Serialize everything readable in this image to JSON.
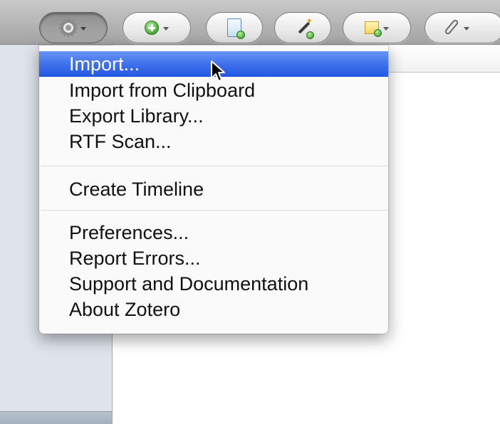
{
  "toolbar": {
    "buttons": [
      {
        "name": "actions",
        "icon": "gear-icon",
        "has_menu": true,
        "pressed": true
      },
      {
        "name": "new-item",
        "icon": "plus-icon",
        "has_menu": true,
        "pressed": false
      },
      {
        "name": "add-item-by-identifier",
        "icon": "document-plus-icon",
        "has_menu": false,
        "pressed": false
      },
      {
        "name": "magic-wand",
        "icon": "magic-wand-plus-icon",
        "has_menu": false,
        "pressed": false
      },
      {
        "name": "new-note",
        "icon": "note-plus-icon",
        "has_menu": true,
        "pressed": false
      },
      {
        "name": "attachment",
        "icon": "paperclip-icon",
        "has_menu": true,
        "pressed": false
      }
    ]
  },
  "menu": {
    "items": [
      {
        "label": "Import...",
        "selected": true
      },
      {
        "label": "Import from Clipboard",
        "selected": false
      },
      {
        "label": "Export Library...",
        "selected": false
      },
      {
        "label": "RTF Scan...",
        "selected": false
      },
      {
        "label": "Create Timeline",
        "selected": false
      },
      {
        "label": "Preferences...",
        "selected": false
      },
      {
        "label": "Report Errors...",
        "selected": false
      },
      {
        "label": "Support and Documentation",
        "selected": false
      },
      {
        "label": "About Zotero",
        "selected": false
      }
    ]
  },
  "colors": {
    "selection": "#3f71ec",
    "menu_text": "#111111",
    "selected_text": "#ffffff",
    "toolbar": "#b4b4b4",
    "side_pane": "#dfe4ea"
  }
}
